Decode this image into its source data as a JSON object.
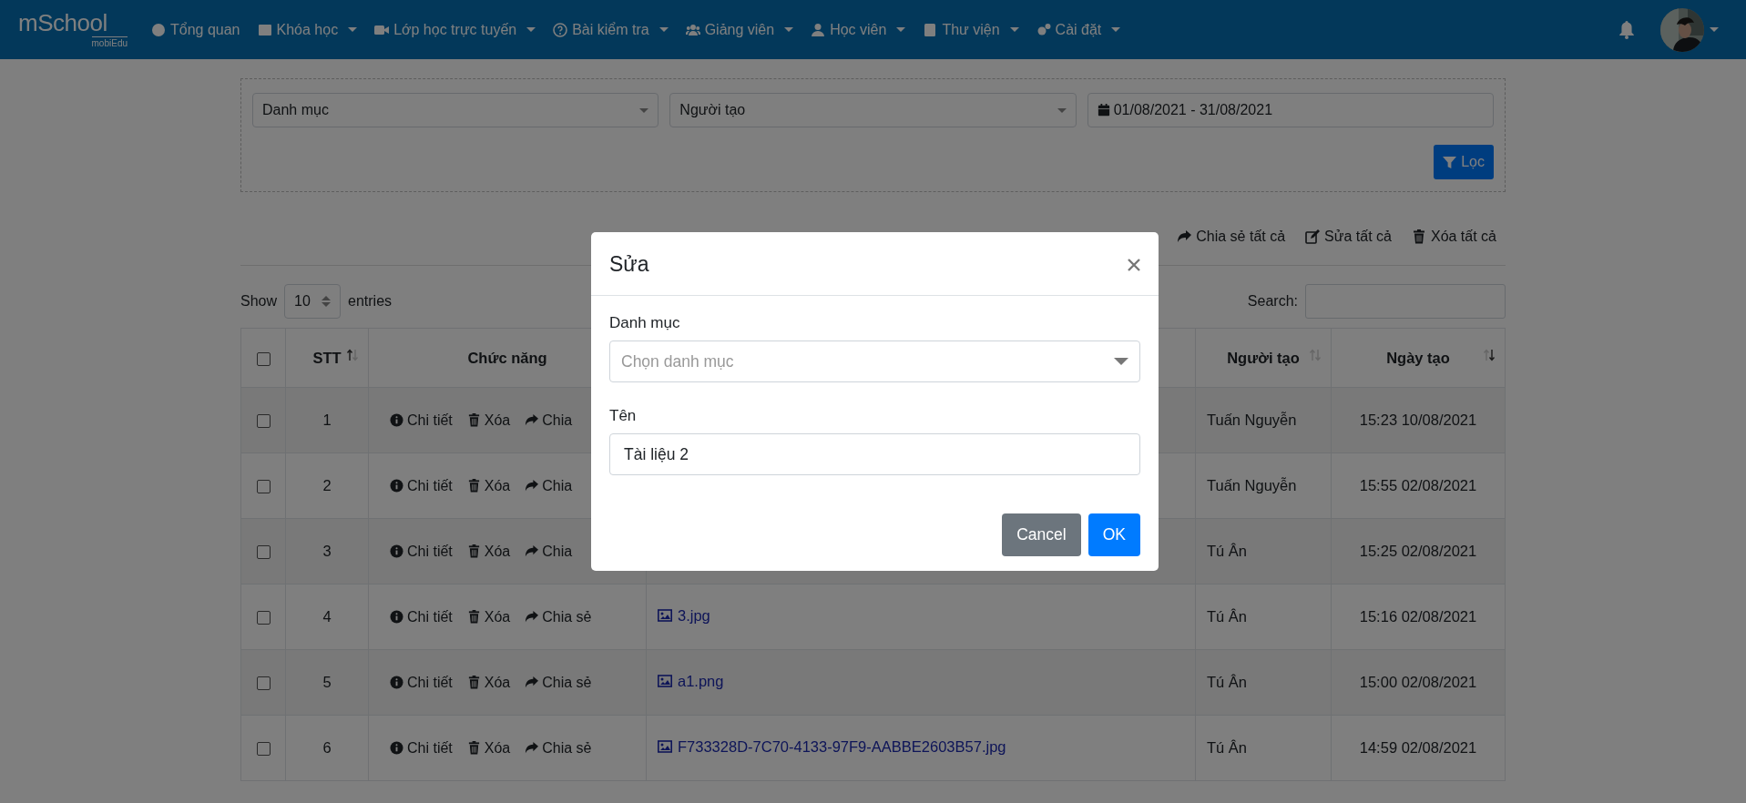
{
  "navbar": {
    "logo": {
      "title": "mSchool",
      "subtitle": "mobiEdu"
    },
    "items": [
      {
        "label": "Tổng quan",
        "dropdown": false
      },
      {
        "label": "Khóa học",
        "dropdown": true
      },
      {
        "label": "Lớp học trực tuyến",
        "dropdown": true
      },
      {
        "label": "Bài kiểm tra",
        "dropdown": true
      },
      {
        "label": "Giảng viên",
        "dropdown": true
      },
      {
        "label": "Học viên",
        "dropdown": true
      },
      {
        "label": "Thư viện",
        "dropdown": true
      },
      {
        "label": "Cài đặt",
        "dropdown": true
      }
    ]
  },
  "filters": {
    "category": {
      "value": "Danh mục"
    },
    "creator": {
      "value": "Người tạo"
    },
    "date_range": {
      "value": "01/08/2021 - 31/08/2021"
    },
    "filter_button": "Lọc"
  },
  "bulk_actions": [
    "Chia sẻ tất cả",
    "Sửa tất cả",
    "Xóa tất cả"
  ],
  "length_control": {
    "prefix": "Show",
    "value": "10",
    "suffix": "entries"
  },
  "search": {
    "label": "Search:"
  },
  "table": {
    "select_all": {
      "checked": false
    },
    "columns": [
      {
        "label": "STT",
        "sorted_ascending": true,
        "sorted_descending": false
      },
      {
        "label": "Chức năng"
      },
      {
        "label": "Người tạo",
        "sorted_ascending": false,
        "sorted_descending": false
      },
      {
        "label": "Ngày tạo",
        "sorted_ascending": false,
        "sorted_descending": true
      }
    ],
    "rows": [
      {
        "checked": false,
        "stt": "1",
        "actions": [
          "Chi tiết",
          "Xóa",
          "Chia"
        ],
        "creator": "Tuấn Nguyễn",
        "created": "15:23 10/08/2021"
      },
      {
        "checked": false,
        "stt": "2",
        "actions": [
          "Chi tiết",
          "Xóa",
          "Chia"
        ],
        "creator": "Tuấn Nguyễn",
        "created": "15:55 02/08/2021"
      },
      {
        "checked": false,
        "stt": "3",
        "actions": [
          "Chi tiết",
          "Xóa",
          "Chia"
        ],
        "creator": "Tú Ân",
        "created": "15:25 02/08/2021"
      },
      {
        "checked": false,
        "stt": "4",
        "actions": [
          "Chi tiết",
          "Xóa",
          "Chia sẻ"
        ],
        "name": "3.jpg",
        "creator": "Tú Ân",
        "created": "15:16 02/08/2021"
      },
      {
        "checked": false,
        "stt": "5",
        "actions": [
          "Chi tiết",
          "Xóa",
          "Chia sẻ"
        ],
        "name": "a1.png",
        "creator": "Tú Ân",
        "created": "15:00 02/08/2021"
      },
      {
        "checked": false,
        "stt": "6",
        "actions": [
          "Chi tiết",
          "Xóa",
          "Chia sẻ"
        ],
        "name": "F733328D-7C70-4133-97F9-AABBE2603B57.jpg",
        "creator": "Tú Ân",
        "created": "14:59 02/08/2021"
      }
    ]
  },
  "modal": {
    "title": "Sửa",
    "fields": [
      {
        "label": "Danh mục",
        "kind": "select",
        "placeholder": "Chọn danh mục"
      },
      {
        "label": "Tên",
        "kind": "text",
        "value": "Tài liệu 2"
      }
    ],
    "buttons": [
      {
        "label": "Cancel",
        "kind": "secondary"
      },
      {
        "label": "OK",
        "kind": "primary"
      }
    ]
  }
}
